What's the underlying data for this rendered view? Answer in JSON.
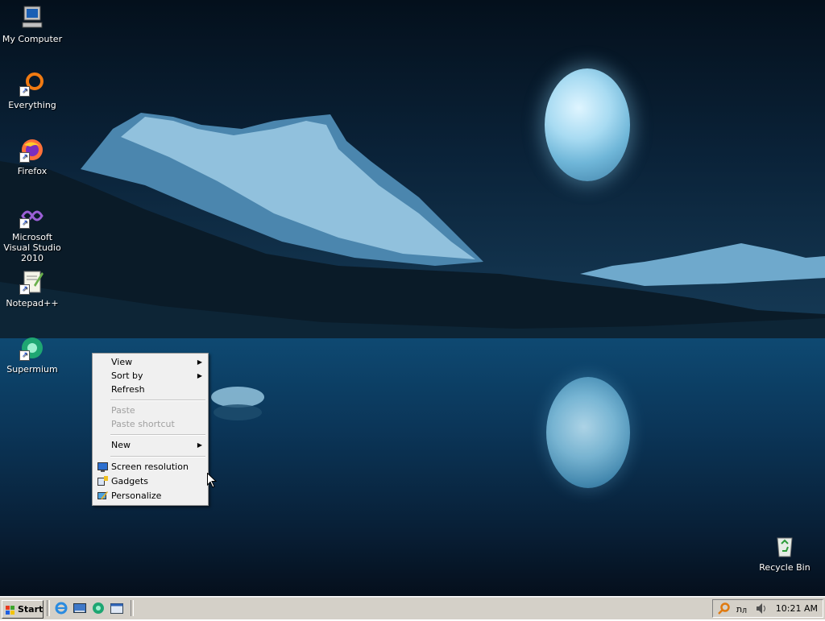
{
  "desktop": {
    "icons": [
      {
        "label": "My Computer",
        "icon": "computer-icon"
      },
      {
        "label": "Everything",
        "icon": "everything-search-icon"
      },
      {
        "label": "Firefox",
        "icon": "firefox-icon"
      },
      {
        "label": "Microsoft Visual Studio 2010",
        "icon": "visual-studio-icon"
      },
      {
        "label": "Notepad++",
        "icon": "notepad-plus-plus-icon"
      },
      {
        "label": "Supermium",
        "icon": "supermium-icon"
      },
      {
        "label": "Recycle Bin",
        "icon": "recycle-bin-icon"
      }
    ]
  },
  "context_menu": {
    "view": "View",
    "sort_by": "Sort by",
    "refresh": "Refresh",
    "paste": "Paste",
    "paste_shortcut": "Paste shortcut",
    "new": "New",
    "screen_resolution": "Screen resolution",
    "gadgets": "Gadgets",
    "personalize": "Personalize",
    "submenu_arrow": "▶"
  },
  "taskbar": {
    "start_label": "Start",
    "quick_launch": [
      "internet-explorer-icon",
      "show-desktop-icon",
      "supermium-icon",
      "windows-explorer-icon"
    ],
    "tray_icons": [
      "search-icon",
      "language-icon",
      "volume-icon"
    ],
    "clock": "10:21 AM"
  },
  "colors": {
    "taskbar": "#d4d0c8",
    "menu_bg": "#f0f0f0",
    "disabled_text": "#a0a0a0"
  }
}
